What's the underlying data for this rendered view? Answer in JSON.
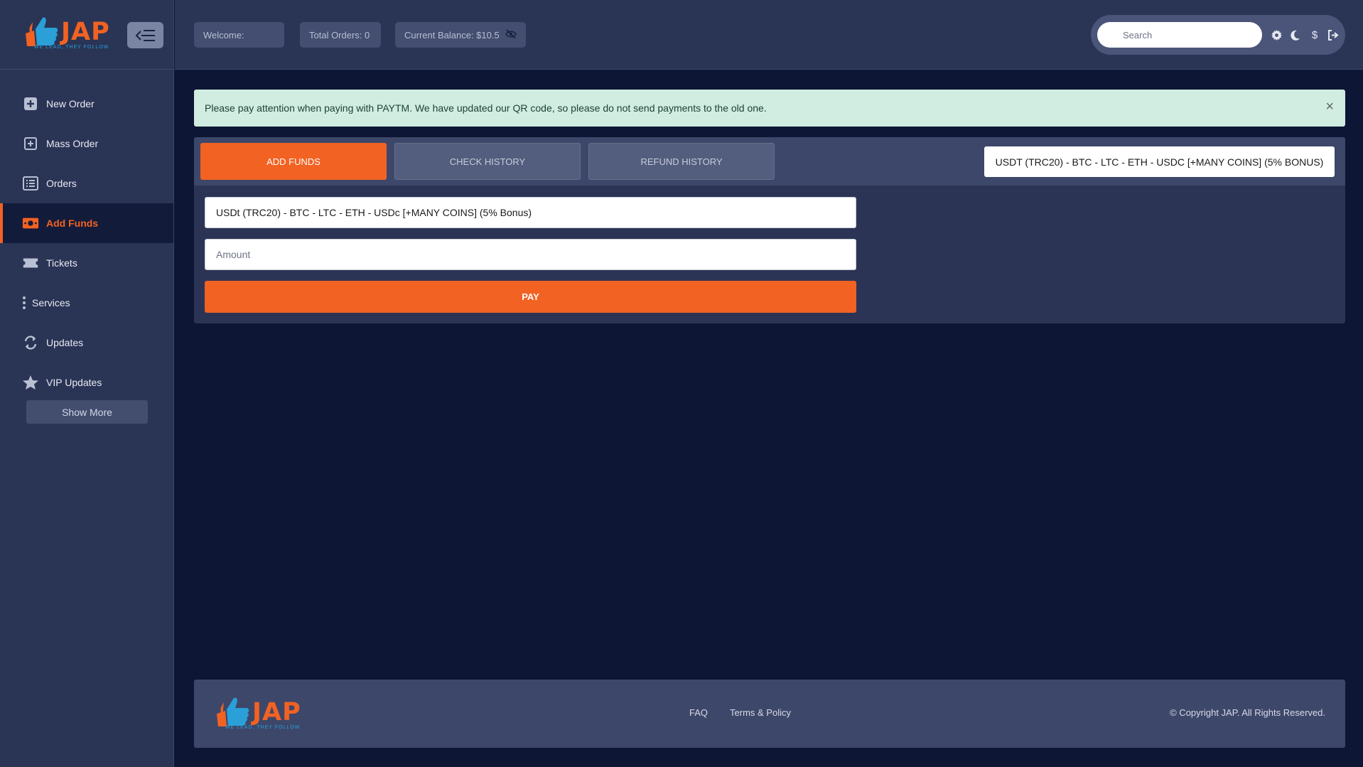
{
  "brand": {
    "name": "JAP",
    "tagline": "WE LEAD, THEY FOLLOW",
    "colors": {
      "primary": "#f26222",
      "accent": "#2a9fd8"
    }
  },
  "sidebar": {
    "items": [
      {
        "label": "New Order",
        "icon": "plus-square-icon"
      },
      {
        "label": "Mass Order",
        "icon": "plus-square-outline-icon"
      },
      {
        "label": "Orders",
        "icon": "list-icon"
      },
      {
        "label": "Add Funds",
        "icon": "money-icon",
        "active": true
      },
      {
        "label": "Tickets",
        "icon": "ticket-icon"
      },
      {
        "label": "Services",
        "icon": "vertical-dots-icon"
      },
      {
        "label": "Updates",
        "icon": "sync-icon"
      },
      {
        "label": "VIP Updates",
        "icon": "star-icon"
      }
    ],
    "show_more": "Show More"
  },
  "header": {
    "welcome": "Welcome:",
    "total_orders": "Total Orders: 0",
    "balance": "Current Balance: $10.5",
    "search_placeholder": "Search",
    "icons": [
      "gear-icon",
      "moon-icon",
      "dollar-icon",
      "logout-icon"
    ]
  },
  "alert": {
    "text": "Please pay attention when paying with PAYTM. We have updated our QR code, so please do not send payments to the old one.",
    "close": "×"
  },
  "funds": {
    "tabs": [
      "ADD FUNDS",
      "CHECK HISTORY",
      "REFUND HISTORY"
    ],
    "active_tab": "ADD FUNDS",
    "method_header": "USDT (TRC20) - BTC - LTC - ETH - USDC [+MANY COINS] (5% BONUS)",
    "method_value": "USDt (TRC20) - BTC - LTC - ETH - USDc [+MANY COINS] (5% Bonus)",
    "amount_placeholder": "Amount",
    "pay_label": "PAY"
  },
  "footer": {
    "links": [
      "FAQ",
      "Terms & Policy"
    ],
    "copyright": "© Copyright JAP. All Rights Reserved."
  }
}
